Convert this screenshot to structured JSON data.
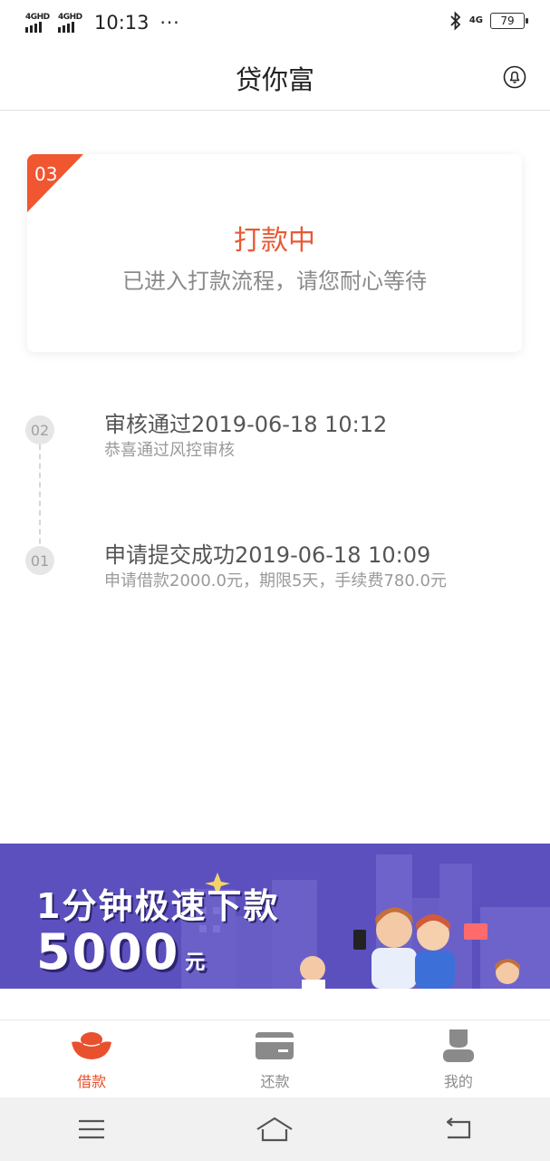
{
  "status_bar": {
    "signal1": "4GHD",
    "signal2": "4GHD",
    "time": "10:13",
    "dots": "···",
    "network": "4G",
    "battery": "79"
  },
  "header": {
    "title": "贷你富",
    "bell_icon": "bell-icon"
  },
  "status_card": {
    "step_number": "03",
    "status_title": "打款中",
    "status_desc": "已进入打款流程，请您耐心等待",
    "accent_color": "#e85a34"
  },
  "timeline": [
    {
      "step": "02",
      "title": "审核通过2019-06-18 10:12",
      "subtitle": "恭喜通过风控审核"
    },
    {
      "step": "01",
      "title": "申请提交成功2019-06-18 10:09",
      "subtitle": "申请借款2000.0元，期限5天，手续费780.0元"
    }
  ],
  "banner": {
    "line1": "1分钟极速下款",
    "amount": "5000",
    "unit": "元",
    "background_color": "#5b50bd"
  },
  "bottom_nav": {
    "items": [
      {
        "label": "借款",
        "icon": "ingot-icon",
        "active": true
      },
      {
        "label": "还款",
        "icon": "card-icon",
        "active": false
      },
      {
        "label": "我的",
        "icon": "person-icon",
        "active": false
      }
    ],
    "active_color": "#e8502e"
  },
  "system_nav": {
    "menu_icon": "menu-icon",
    "home_icon": "home-icon",
    "back_icon": "back-icon"
  }
}
